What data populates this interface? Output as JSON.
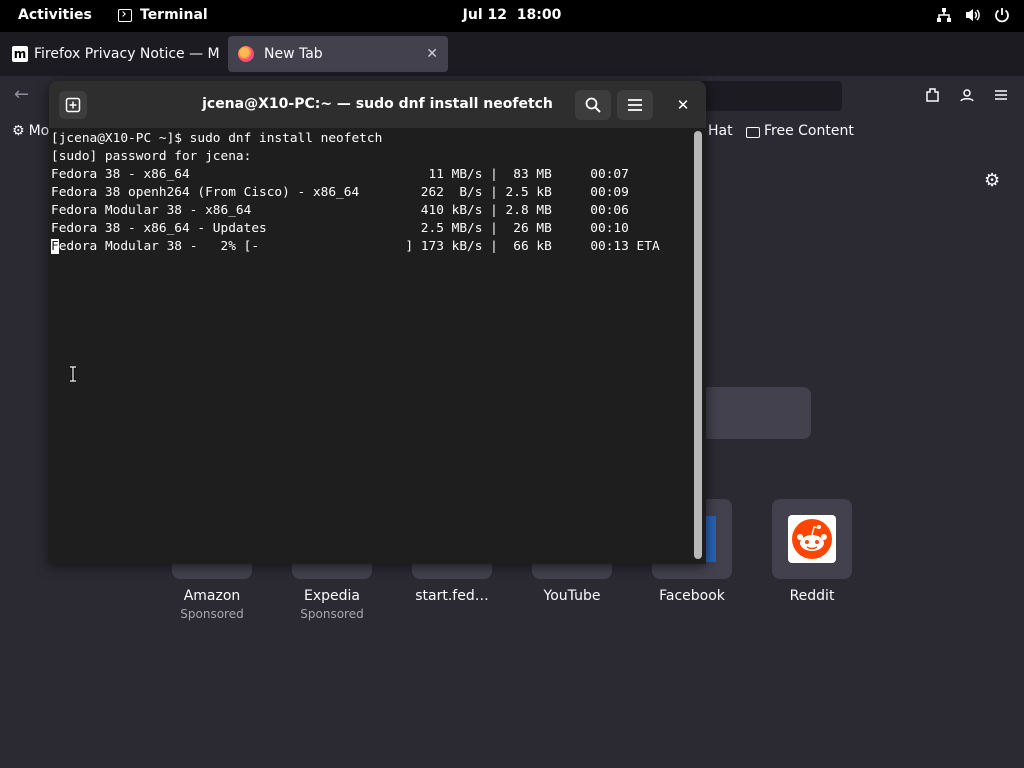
{
  "topbar": {
    "activities": "Activities",
    "app_name": "Terminal",
    "date": "Jul 12",
    "time": "18:00",
    "tray_icons": [
      "network-icon",
      "volume-icon",
      "power-icon"
    ]
  },
  "firefox": {
    "tabs": [
      {
        "favicon": "m",
        "label": "Firefox Privacy Notice — M",
        "active": false
      },
      {
        "favicon": "firefox-icon",
        "label": "New Tab",
        "active": true
      }
    ],
    "new_tab_button": "+",
    "window_close": "✕",
    "bookmarks": {
      "first": "Mo",
      "hat": "Hat",
      "free_content": "Free Content"
    },
    "top_sites": [
      {
        "name": "Amazon",
        "sub": "Sponsored"
      },
      {
        "name": "Expedia",
        "sub": "Sponsored"
      },
      {
        "name": "start.fed…",
        "sub": ""
      },
      {
        "name": "YouTube",
        "sub": ""
      },
      {
        "name": "Facebook",
        "sub": ""
      },
      {
        "name": "Reddit",
        "sub": ""
      }
    ],
    "colors": {
      "reddit": "#ff4500",
      "facebook": "#1877f2"
    }
  },
  "terminal": {
    "title": "jcena@X10-PC:~ — sudo dnf install neofetch",
    "close": "✕",
    "lines": [
      "[jcena@X10-PC ~]$ sudo dnf install neofetch",
      "[sudo] password for jcena:",
      "Fedora 38 - x86_64                               11 MB/s |  83 MB     00:07",
      "Fedora 38 openh264 (From Cisco) - x86_64        262  B/s | 2.5 kB     00:09",
      "Fedora Modular 38 - x86_64                      410 kB/s | 2.8 MB     00:06",
      "Fedora 38 - x86_64 - Updates                    2.5 MB/s |  26 MB     00:10"
    ],
    "progress_cursor_char": "F",
    "progress_line_rest": "edora Modular 38 -   2% [-                   ] 173 kB/s |  66 kB     00:13 ETA"
  }
}
